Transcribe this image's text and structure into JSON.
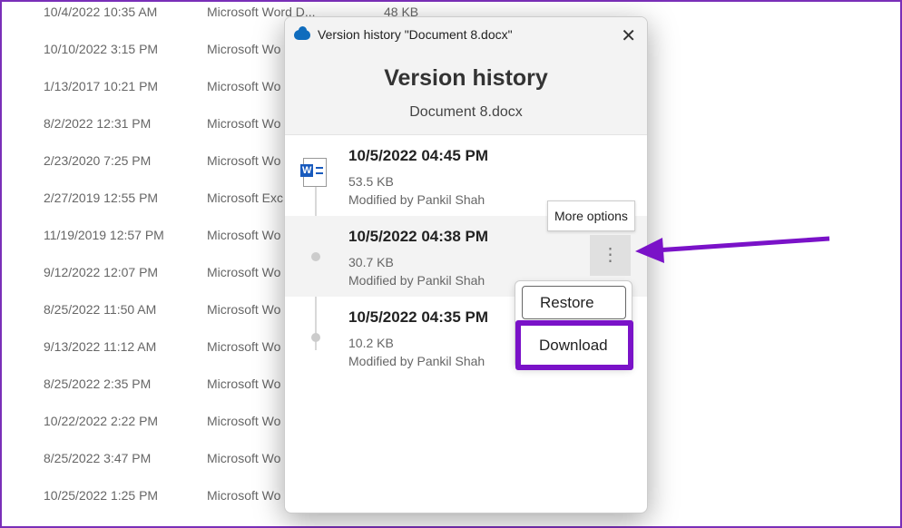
{
  "file_list": [
    {
      "date": "10/4/2022 10:35 AM",
      "type": "Microsoft Word D...",
      "size": "48 KB"
    },
    {
      "date": "10/10/2022 3:15 PM",
      "type": "Microsoft Wo",
      "size": ""
    },
    {
      "date": "1/13/2017 10:21 PM",
      "type": "Microsoft Wo",
      "size": ""
    },
    {
      "date": "8/2/2022 12:31 PM",
      "type": "Microsoft Wo",
      "size": ""
    },
    {
      "date": "2/23/2020 7:25 PM",
      "type": "Microsoft Wo",
      "size": ""
    },
    {
      "date": "2/27/2019 12:55 PM",
      "type": "Microsoft Exc",
      "size": ""
    },
    {
      "date": "11/19/2019 12:57 PM",
      "type": "Microsoft Wo",
      "size": ""
    },
    {
      "date": "9/12/2022 12:07 PM",
      "type": "Microsoft Wo",
      "size": ""
    },
    {
      "date": "8/25/2022 11:50 AM",
      "type": "Microsoft Wo",
      "size": ""
    },
    {
      "date": "9/13/2022 11:12 AM",
      "type": "Microsoft Wo",
      "size": ""
    },
    {
      "date": "8/25/2022 2:35 PM",
      "type": "Microsoft Wo",
      "size": ""
    },
    {
      "date": "10/22/2022 2:22 PM",
      "type": "Microsoft Wo",
      "size": ""
    },
    {
      "date": "8/25/2022 3:47 PM",
      "type": "Microsoft Wo",
      "size": ""
    },
    {
      "date": "10/25/2022 1:25 PM",
      "type": "Microsoft Wo",
      "size": ""
    }
  ],
  "dialog": {
    "window_title": "Version history \"Document 8.docx\"",
    "heading": "Version history",
    "filename": "Document 8.docx",
    "versions": [
      {
        "date": "10/5/2022 04:45 PM",
        "size": "53.5 KB",
        "modified": "Modified by Pankil Shah"
      },
      {
        "date": "10/5/2022 04:38 PM",
        "size": "30.7 KB",
        "modified": "Modified by Pankil Shah"
      },
      {
        "date": "10/5/2022 04:35 PM",
        "size": "10.2 KB",
        "modified": "Modified by Pankil Shah"
      }
    ],
    "tooltip": "More options",
    "menu": {
      "restore": "Restore",
      "download": "Download"
    }
  },
  "colors": {
    "highlight": "#7a12c8",
    "onedrive": "#0f6cbd"
  }
}
